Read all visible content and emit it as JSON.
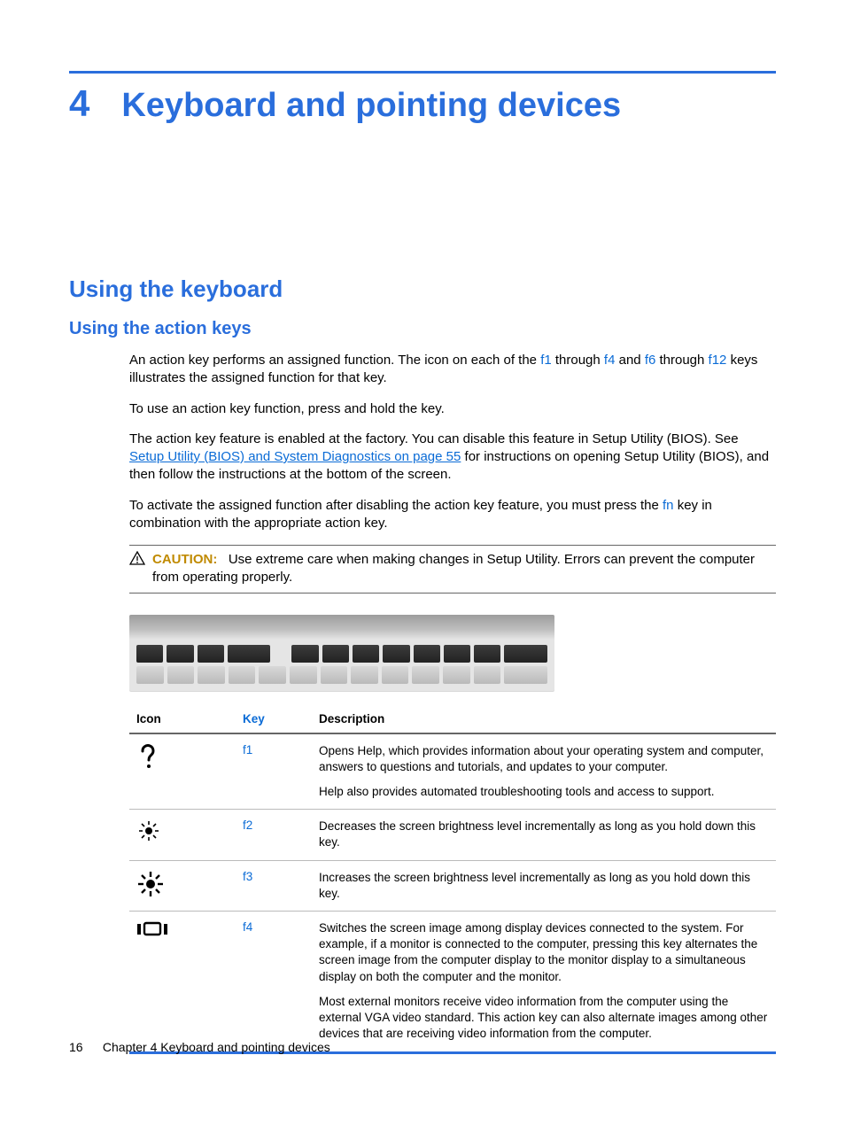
{
  "chapter": {
    "number": "4",
    "title": "Keyboard and pointing devices"
  },
  "section": {
    "title": "Using the keyboard"
  },
  "subsection": {
    "title": "Using the action keys"
  },
  "paragraphs": {
    "p1_pre": "An action key performs an assigned function. The icon on each of the ",
    "p1_k1": "f1",
    "p1_mid1": " through ",
    "p1_k2": "f4",
    "p1_mid2": " and ",
    "p1_k3": "f6",
    "p1_mid3": " through ",
    "p1_k4": "f12",
    "p1_post": " keys illustrates the assigned function for that key.",
    "p2": "To use an action key function, press and hold the key.",
    "p3_pre": "The action key feature is enabled at the factory. You can disable this feature in Setup Utility (BIOS). See ",
    "p3_link": "Setup Utility (BIOS) and System Diagnostics on page 55",
    "p3_post": " for instructions on opening Setup Utility (BIOS), and then follow the instructions at the bottom of the screen.",
    "p4_pre": "To activate the assigned function after disabling the action key feature, you must press the ",
    "p4_key": "fn",
    "p4_post": " key in combination with the appropriate action key."
  },
  "caution": {
    "label": "CAUTION:",
    "text": "Use extreme care when making changes in Setup Utility. Errors can prevent the computer from operating properly."
  },
  "table": {
    "headers": {
      "icon": "Icon",
      "key": "Key",
      "desc": "Description"
    },
    "rows": [
      {
        "icon": "help-icon",
        "key": "f1",
        "desc": [
          "Opens Help, which provides information about your operating system and computer, answers to questions and tutorials, and updates to your computer.",
          "Help also provides automated troubleshooting tools and access to support."
        ]
      },
      {
        "icon": "brightness-down-icon",
        "key": "f2",
        "desc": [
          "Decreases the screen brightness level incrementally as long as you hold down this key."
        ]
      },
      {
        "icon": "brightness-up-icon",
        "key": "f3",
        "desc": [
          "Increases the screen brightness level incrementally as long as you hold down this key."
        ]
      },
      {
        "icon": "switch-display-icon",
        "key": "f4",
        "desc": [
          "Switches the screen image among display devices connected to the system. For example, if a monitor is connected to the computer, pressing this key alternates the screen image from the computer display to the monitor display to a simultaneous display on both the computer and the monitor.",
          "Most external monitors receive video information from the computer using the external VGA video standard. This action key can also alternate images among other devices that are receiving video information from the computer."
        ]
      }
    ]
  },
  "footer": {
    "page": "16",
    "chapter_label": "Chapter 4   Keyboard and pointing devices"
  }
}
